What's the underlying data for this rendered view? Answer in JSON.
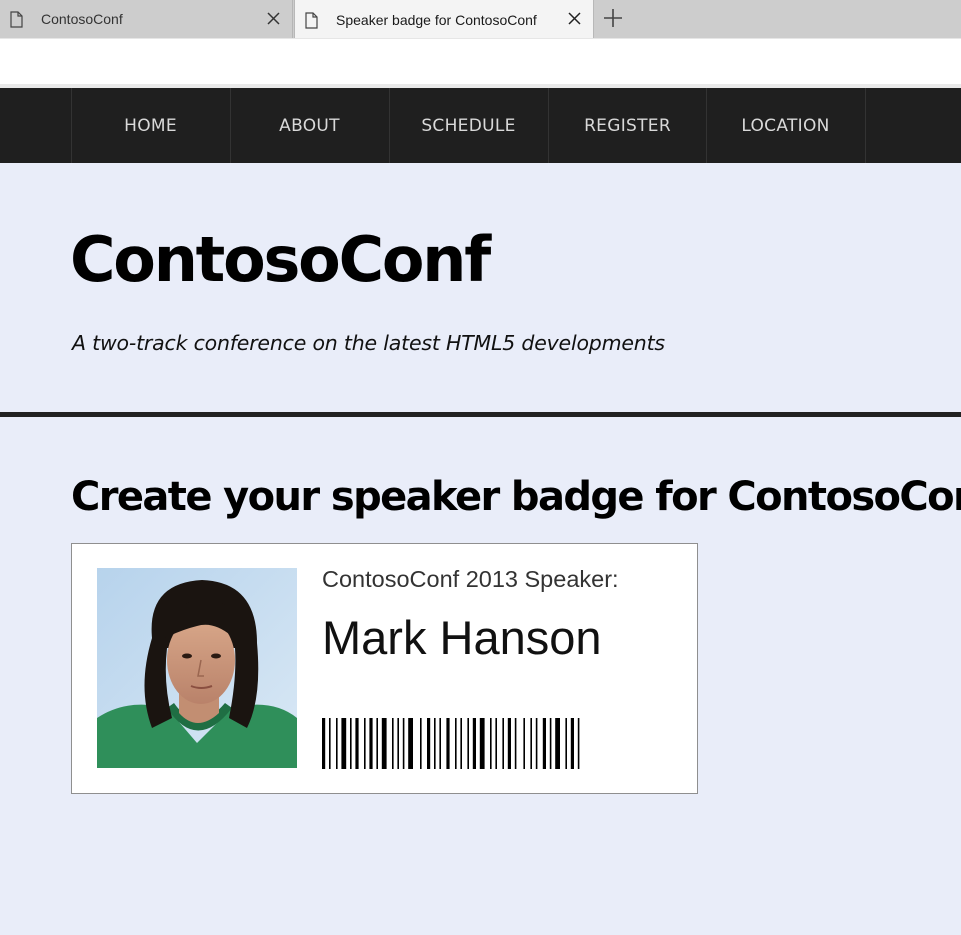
{
  "browser": {
    "tabs": [
      {
        "title": "ContosoConf",
        "active": false
      },
      {
        "title": "Speaker badge for ContosoConf",
        "active": true
      }
    ],
    "icons": [
      "document-icon",
      "close-icon",
      "new-tab-icon"
    ]
  },
  "nav": {
    "items": [
      "HOME",
      "ABOUT",
      "SCHEDULE",
      "REGISTER",
      "LOCATION"
    ]
  },
  "header": {
    "title": "ContosoConf",
    "tagline": "A two-track conference on the latest HTML5 developments"
  },
  "main": {
    "heading": "Create your speaker badge for ContosoConf",
    "badge": {
      "label": "ContosoConf 2013 Speaker:",
      "name": "Mark Hanson",
      "photo": "speaker-photo"
    }
  },
  "colors": {
    "page_background": "#e9edf9",
    "nav_background": "#1f1f1f",
    "nav_text": "#d9d9d9",
    "divider": "#222222"
  }
}
